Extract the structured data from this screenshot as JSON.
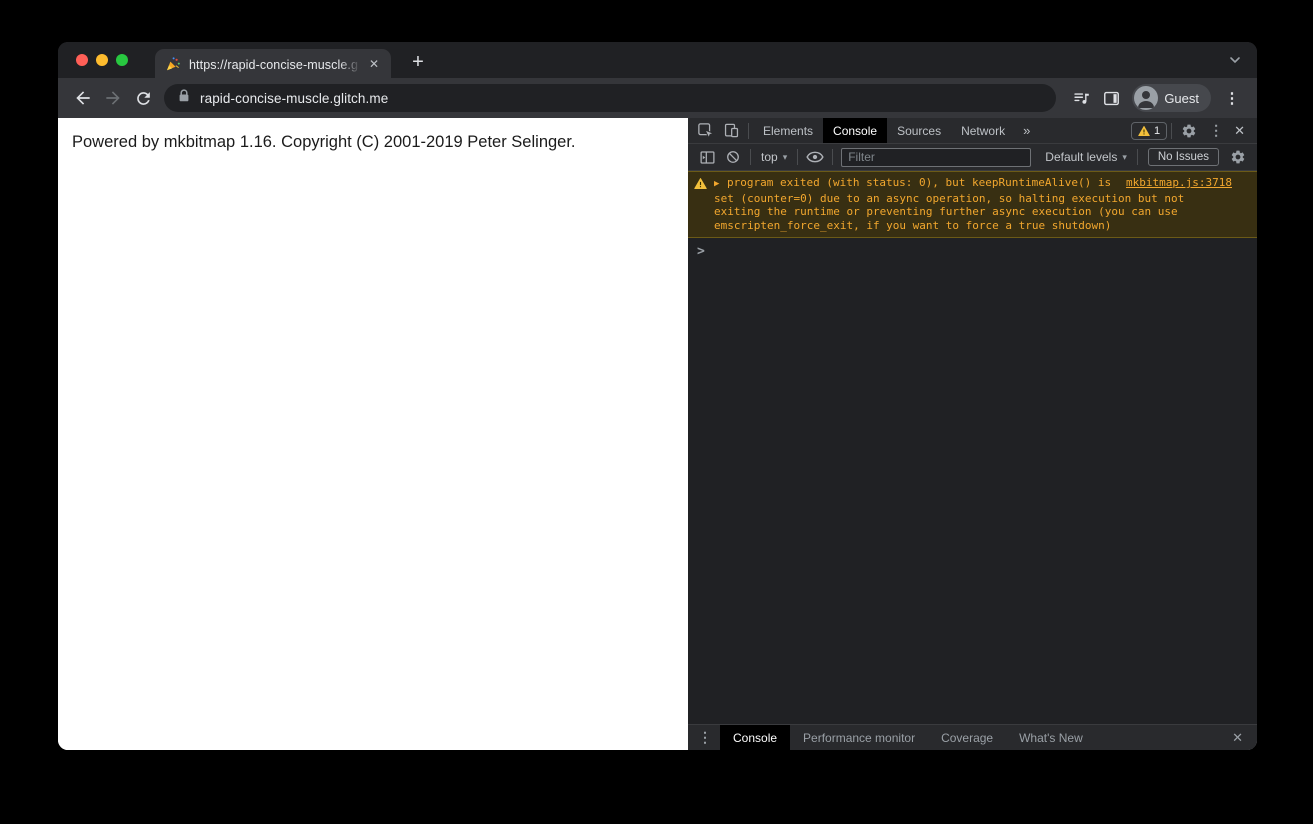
{
  "browser": {
    "tab_title": "https://rapid-concise-muscle.g",
    "url": "rapid-concise-muscle.glitch.me",
    "profile_label": "Guest"
  },
  "page": {
    "text": "Powered by mkbitmap 1.16. Copyright (C) 2001-2019 Peter Selinger."
  },
  "devtools": {
    "main_tabs": [
      {
        "label": "Elements"
      },
      {
        "label": "Console"
      },
      {
        "label": "Sources"
      },
      {
        "label": "Network"
      }
    ],
    "active_main_tab": "Console",
    "warning_badge_count": "1",
    "toolbar": {
      "context_selector": "top",
      "filter_placeholder": "Filter",
      "levels_selector": "Default levels",
      "issues_label": "No Issues"
    },
    "console_message": {
      "level": "warning",
      "text": "program exited (with status: 0), but keepRuntimeAlive() is set (counter=0) due to an async operation, so halting execution but not exiting the runtime or preventing further async execution (you can use emscripten_force_exit, if you want to force a true shutdown)",
      "source": "mkbitmap.js:3718"
    },
    "prompt_glyph": ">",
    "drawer_tabs": [
      {
        "label": "Console"
      },
      {
        "label": "Performance monitor"
      },
      {
        "label": "Coverage"
      },
      {
        "label": "What's New"
      }
    ],
    "active_drawer_tab": "Console"
  },
  "icons": {
    "close": "✕",
    "plus": "+",
    "kebab": "⋮",
    "more_tabs": "»",
    "caret_down": "▾",
    "expand_arrow": "▶"
  },
  "colors": {
    "warning_bg": "#382f12",
    "warning_text": "#f2a72e",
    "warning_border": "#6b5a17",
    "badge_triangle": "#f2c03c",
    "devtools_bg": "#202124",
    "devtools_toolbar_bg": "#292a2d",
    "browser_toolbar_bg": "#35363a",
    "tabstrip_bg": "#202124",
    "traffic_red": "#ff5f57",
    "traffic_yellow": "#febc2e",
    "traffic_green": "#28c840"
  }
}
